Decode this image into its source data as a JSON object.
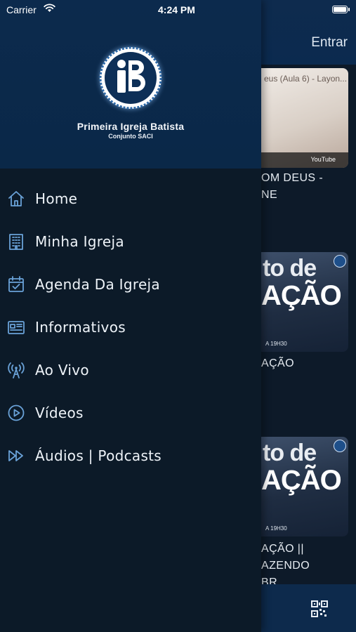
{
  "status_bar": {
    "carrier": "Carrier",
    "time": "4:24 PM"
  },
  "brand": {
    "title": "Primeira Igreja Batista",
    "subtitle": "Conjunto SACI"
  },
  "menu": {
    "items": [
      {
        "label": "Home",
        "icon": "home-icon"
      },
      {
        "label": "Minha Igreja",
        "icon": "building-icon"
      },
      {
        "label": "Agenda Da Igreja",
        "icon": "calendar-check-icon"
      },
      {
        "label": "Informativos",
        "icon": "newspaper-icon"
      },
      {
        "label": "Ao Vivo",
        "icon": "antenna-icon"
      },
      {
        "label": "Vídeos",
        "icon": "play-circle-icon"
      },
      {
        "label": "Áudios | Podcasts",
        "icon": "fast-forward-icon"
      }
    ]
  },
  "background": {
    "header_action": "Entrar",
    "video_thumb_title": "eus (Aula 6) - Layon...",
    "video_thumb_source": "YouTube",
    "cards": [
      {
        "caption_line1": "OM DEUS -",
        "caption_line2": "NE"
      },
      {
        "poster_line1": "to de",
        "poster_line2": "AÇÃO",
        "poster_small": "A 19H30",
        "caption_line1": "AÇÃO"
      },
      {
        "poster_line1": "to de",
        "poster_line2": "AÇÃO",
        "poster_small": "A 19H30",
        "caption_line1": "AÇÃO ||",
        "caption_line2": "AZENDO",
        "caption_line3": "BR"
      }
    ]
  },
  "colors": {
    "drawer_bg": "#0c1a28",
    "header_bg": "#0b2a4d",
    "icon_accent": "#6aa2d8",
    "text": "#eef3f8"
  }
}
